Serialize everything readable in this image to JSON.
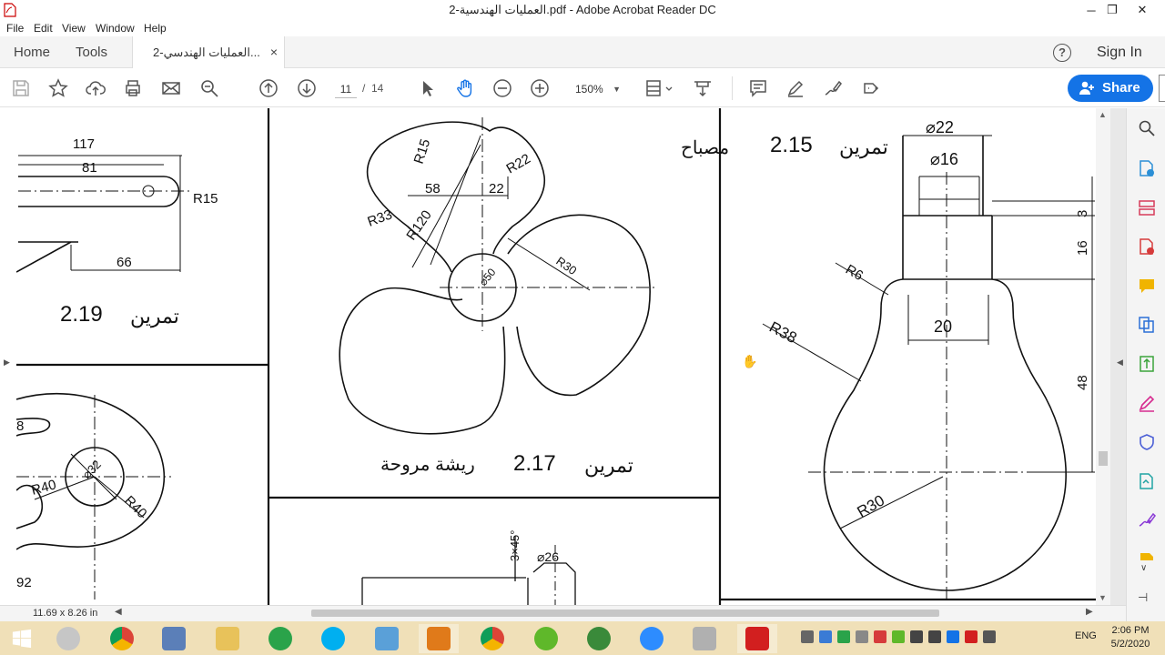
{
  "window": {
    "title": "العمليات الهندسية-2.pdf - Adobe Acrobat Reader DC",
    "minimize": "─",
    "maximize": "❐",
    "close": "✕"
  },
  "menu": [
    "File",
    "Edit",
    "View",
    "Window",
    "Help"
  ],
  "tabs": {
    "home": "Home",
    "tools": "Tools",
    "document": "2-العمليات الهندسي...",
    "close": "×",
    "help": "?",
    "sign_in": "Sign In"
  },
  "toolbar": {
    "current_page": "11",
    "page_separator": "/",
    "total_pages": "14",
    "zoom": "150%",
    "share": "Share"
  },
  "status": {
    "page_size": "11.69 x 8.26 in"
  },
  "drawing": {
    "left_top": {
      "dims": [
        "117",
        "81",
        "R15",
        "66"
      ],
      "exercise": "تمرين",
      "exercise_num": "2.19"
    },
    "left_bottom": {
      "dims": [
        "8",
        "R40",
        "⌀32",
        "R40",
        "92"
      ]
    },
    "fan": {
      "dims": [
        "R15",
        "R22",
        "58",
        "22",
        "R33",
        "R120",
        "R30",
        "⌀50"
      ],
      "exercise": "تمرين",
      "exercise_num": "2.17",
      "caption": "ريشة مروحة"
    },
    "lamp": {
      "dims": [
        "⌀22",
        "⌀16",
        "3",
        "16",
        "R6",
        "20",
        "R38",
        "48",
        "R30"
      ],
      "exercise": "تمرين",
      "exercise_num": "2.15",
      "caption": "مصباح"
    },
    "bottom_mid": {
      "dims": [
        "3×45°",
        "⌀26"
      ]
    }
  },
  "taskbar": {
    "language": "ENG",
    "time": "2:06 PM",
    "date": "5/2/2020"
  },
  "colors": {
    "share_blue": "#1473e6",
    "taskbar": "#f0e0b8",
    "toolbar_icon": "#555555"
  }
}
